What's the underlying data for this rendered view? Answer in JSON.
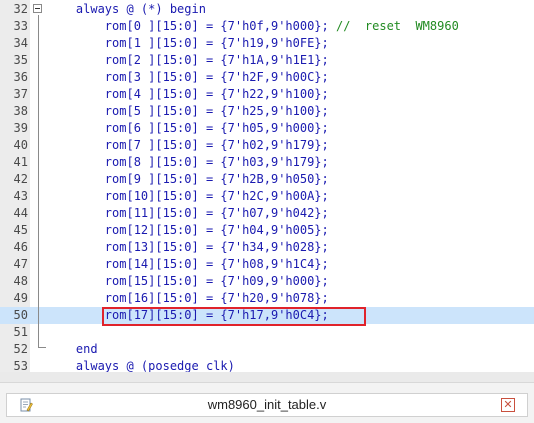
{
  "editor": {
    "lines": [
      {
        "num": "32",
        "parts": [
          {
            "t": "    ",
            "c": ""
          },
          {
            "t": "always @ (*) begin",
            "c": "kw"
          }
        ]
      },
      {
        "num": "33",
        "parts": [
          {
            "t": "        ",
            "c": ""
          },
          {
            "t": "rom[0 ][15:0] = {7'h0f,9'h000};",
            "c": "reg"
          },
          {
            "t": " //  reset  WM8960",
            "c": "cm"
          }
        ]
      },
      {
        "num": "34",
        "parts": [
          {
            "t": "        ",
            "c": ""
          },
          {
            "t": "rom[1 ][15:0] = {7'h19,9'h0FE};",
            "c": "reg"
          }
        ]
      },
      {
        "num": "35",
        "parts": [
          {
            "t": "        ",
            "c": ""
          },
          {
            "t": "rom[2 ][15:0] = {7'h1A,9'h1E1};",
            "c": "reg"
          }
        ]
      },
      {
        "num": "36",
        "parts": [
          {
            "t": "        ",
            "c": ""
          },
          {
            "t": "rom[3 ][15:0] = {7'h2F,9'h00C};",
            "c": "reg"
          }
        ]
      },
      {
        "num": "37",
        "parts": [
          {
            "t": "        ",
            "c": ""
          },
          {
            "t": "rom[4 ][15:0] = {7'h22,9'h100};",
            "c": "reg"
          }
        ]
      },
      {
        "num": "38",
        "parts": [
          {
            "t": "        ",
            "c": ""
          },
          {
            "t": "rom[5 ][15:0] = {7'h25,9'h100};",
            "c": "reg"
          }
        ]
      },
      {
        "num": "39",
        "parts": [
          {
            "t": "        ",
            "c": ""
          },
          {
            "t": "rom[6 ][15:0] = {7'h05,9'h000};",
            "c": "reg"
          }
        ]
      },
      {
        "num": "40",
        "parts": [
          {
            "t": "        ",
            "c": ""
          },
          {
            "t": "rom[7 ][15:0] = {7'h02,9'h179};",
            "c": "reg"
          }
        ]
      },
      {
        "num": "41",
        "parts": [
          {
            "t": "        ",
            "c": ""
          },
          {
            "t": "rom[8 ][15:0] = {7'h03,9'h179};",
            "c": "reg"
          }
        ]
      },
      {
        "num": "42",
        "parts": [
          {
            "t": "        ",
            "c": ""
          },
          {
            "t": "rom[9 ][15:0] = {7'h2B,9'h050};",
            "c": "reg"
          }
        ]
      },
      {
        "num": "43",
        "parts": [
          {
            "t": "        ",
            "c": ""
          },
          {
            "t": "rom[10][15:0] = {7'h2C,9'h00A};",
            "c": "reg"
          }
        ]
      },
      {
        "num": "44",
        "parts": [
          {
            "t": "        ",
            "c": ""
          },
          {
            "t": "rom[11][15:0] = {7'h07,9'h042};",
            "c": "reg"
          }
        ]
      },
      {
        "num": "45",
        "parts": [
          {
            "t": "        ",
            "c": ""
          },
          {
            "t": "rom[12][15:0] = {7'h04,9'h005};",
            "c": "reg"
          }
        ]
      },
      {
        "num": "46",
        "parts": [
          {
            "t": "        ",
            "c": ""
          },
          {
            "t": "rom[13][15:0] = {7'h34,9'h028};",
            "c": "reg"
          }
        ]
      },
      {
        "num": "47",
        "parts": [
          {
            "t": "        ",
            "c": ""
          },
          {
            "t": "rom[14][15:0] = {7'h08,9'h1C4};",
            "c": "reg"
          }
        ]
      },
      {
        "num": "48",
        "parts": [
          {
            "t": "        ",
            "c": ""
          },
          {
            "t": "rom[15][15:0] = {7'h09,9'h000};",
            "c": "reg"
          }
        ]
      },
      {
        "num": "49",
        "parts": [
          {
            "t": "        ",
            "c": ""
          },
          {
            "t": "rom[16][15:0] = {7'h20,9'h078};",
            "c": "reg"
          }
        ]
      },
      {
        "num": "50",
        "parts": [
          {
            "t": "        ",
            "c": ""
          },
          {
            "t": "rom[17][15:0] = {7'h17,9'h0C4};",
            "c": "reg"
          }
        ],
        "highlight": true
      },
      {
        "num": "51",
        "parts": []
      },
      {
        "num": "52",
        "parts": [
          {
            "t": "    ",
            "c": ""
          },
          {
            "t": "end",
            "c": "kw"
          }
        ]
      },
      {
        "num": "53",
        "parts": [
          {
            "t": "    ",
            "c": ""
          },
          {
            "t": "always @ (posedge clk)",
            "c": "kw"
          }
        ]
      }
    ]
  },
  "tab": {
    "title": "wm8960_init_table.v",
    "file_icon": "file-edit-icon",
    "close_icon": "close-icon",
    "close_glyph": "✕"
  },
  "colors": {
    "keyword": "#1a1ab0",
    "comment": "#228b22",
    "highlight_line": "#cce4fb",
    "selection_border": "#e0232b"
  }
}
